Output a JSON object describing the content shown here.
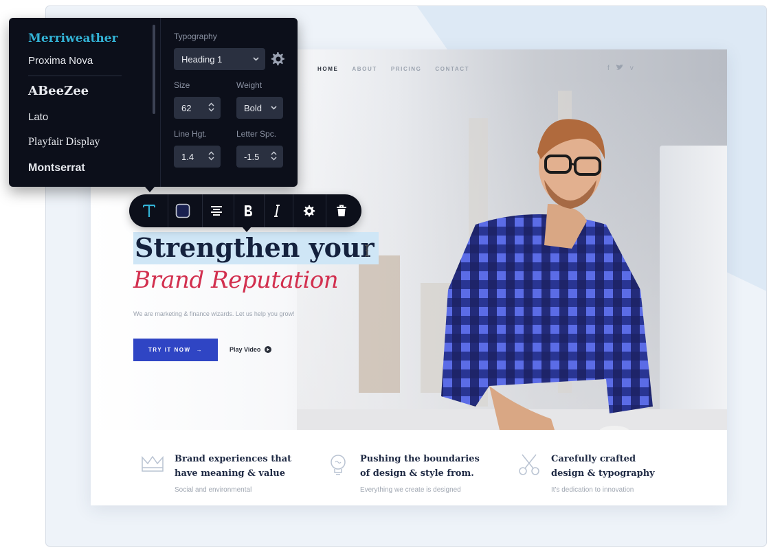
{
  "font_panel": {
    "fonts": [
      "Merriweather",
      "Proxima Nova",
      "ABeeZee",
      "Lato",
      "Playfair Display",
      "Montserrat"
    ],
    "selected_font": "Merriweather"
  },
  "typography": {
    "section_label": "Typography",
    "style_select": "Heading 1",
    "size_label": "Size",
    "size_value": "62",
    "weight_label": "Weight",
    "weight_value": "Bold",
    "line_height_label": "Line Hgt.",
    "line_height_value": "1.4",
    "letter_spacing_label": "Letter Spc.",
    "letter_spacing_value": "-1.5"
  },
  "toolbar": {
    "tools": [
      "text",
      "color",
      "align",
      "bold",
      "italic",
      "settings",
      "delete"
    ],
    "active_tool": "text",
    "accent_color": "#33b3d6"
  },
  "site": {
    "nav": [
      "HOME",
      "ABOUT",
      "PRICING",
      "CONTACT"
    ],
    "active_nav": "HOME",
    "social": [
      "f",
      "t",
      "v"
    ],
    "headline": "Strengthen your",
    "subheadline": "Brand Reputation",
    "tagline": "We are marketing & finance wizards. Let us help you grow!",
    "cta_label": "TRY IT NOW",
    "cta_arrow": "→",
    "play_label": "Play Video",
    "brand_color": "#2f45c4",
    "accent_color": "#d2304f",
    "features": [
      {
        "icon": "crown-icon",
        "title_line1": "Brand experiences that",
        "title_line2": "have meaning & value",
        "desc": "Social and environmental"
      },
      {
        "icon": "lightbulb-icon",
        "title_line1": "Pushing the boundaries",
        "title_line2": "of design & style from.",
        "desc": "Everything we create is designed"
      },
      {
        "icon": "scissors-icon",
        "title_line1": "Carefully crafted",
        "title_line2": "design & typography",
        "desc": "It's dedication to innovation"
      }
    ]
  }
}
